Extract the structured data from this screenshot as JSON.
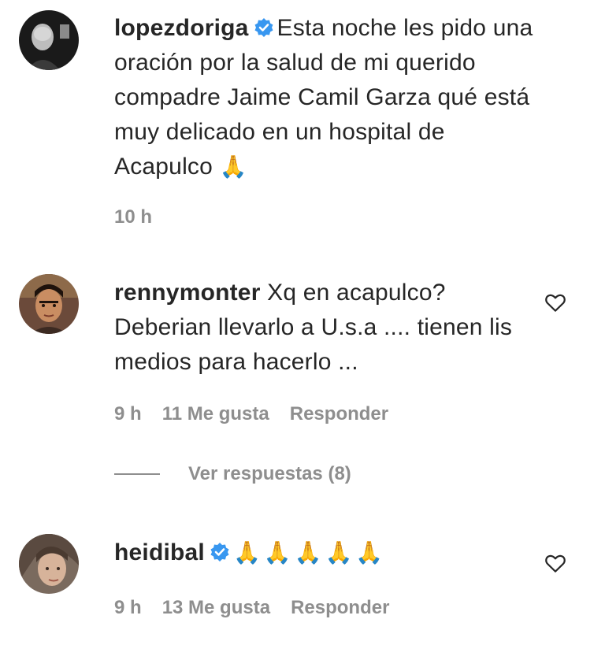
{
  "comments": [
    {
      "username": "lopezdoriga",
      "verified": true,
      "text": "Esta noche les pido una oración por la salud de mi querido compadre Jaime Camil Garza qué está muy delicado en un hospital de Acapulco",
      "emoji": "🙏",
      "time": "10 h"
    },
    {
      "username": "rennymonter",
      "verified": false,
      "text": "Xq en acapulco? Deberian llevarlo a U.s.a .... tienen lis medios para hacerlo ...",
      "time": "9 h",
      "likes": "11 Me gusta",
      "reply": "Responder"
    },
    {
      "username": "heidibal",
      "verified": true,
      "text": "",
      "emoji": "🙏🙏🙏🙏🙏",
      "time": "9 h",
      "likes": "13 Me gusta",
      "reply": "Responder"
    }
  ],
  "view_replies": "Ver respuestas (8)",
  "icons": {
    "verified": "verified-badge-icon",
    "like": "heart-outline-icon"
  },
  "colors": {
    "text": "#262626",
    "secondary": "#8e8e8e",
    "verified": "#3897f0"
  }
}
